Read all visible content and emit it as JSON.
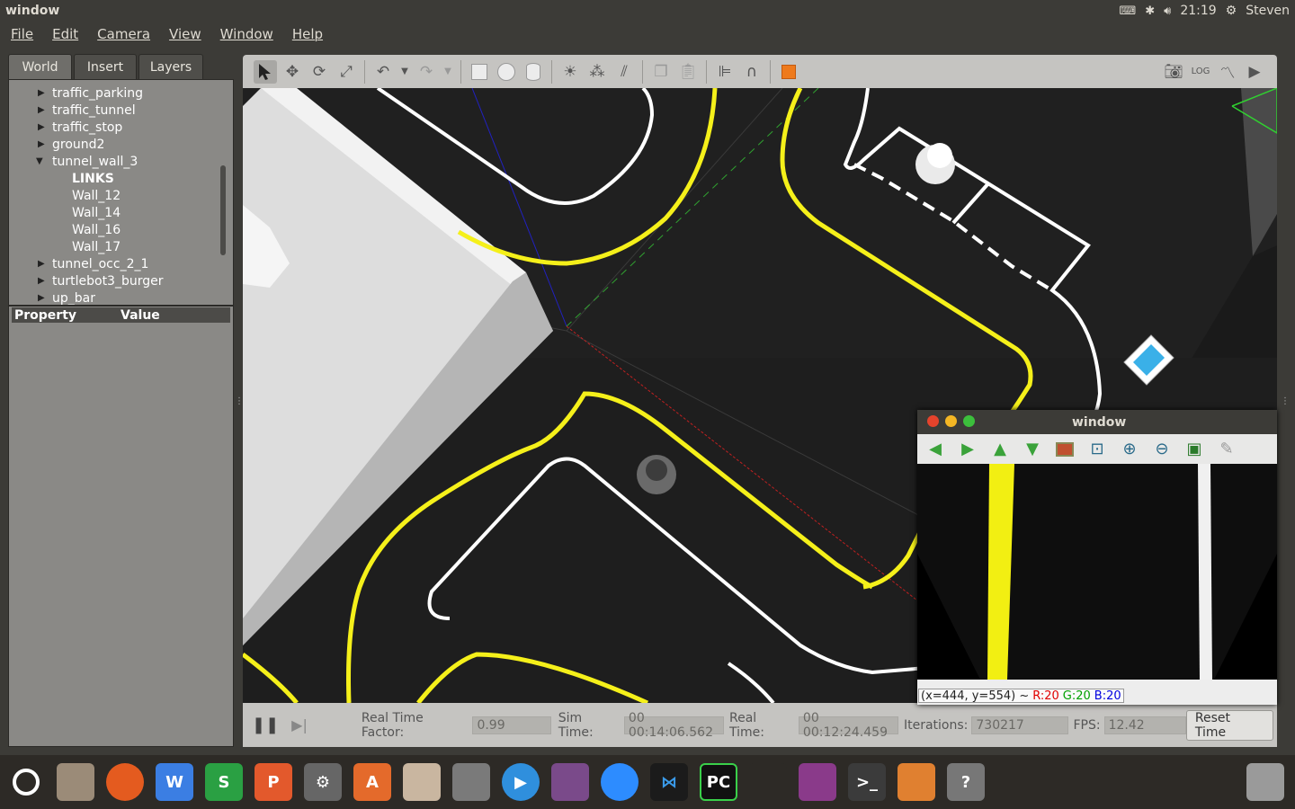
{
  "topbar": {
    "title": "window",
    "clock": "21:19",
    "user": "Steven",
    "icons": [
      "keyboard-icon",
      "bluetooth-icon",
      "volume-icon",
      "settings-gear-icon"
    ]
  },
  "menu": [
    "File",
    "Edit",
    "Camera",
    "View",
    "Window",
    "Help"
  ],
  "left_panel": {
    "tabs": [
      "World",
      "Insert",
      "Layers"
    ],
    "active_tab": "World",
    "tree": [
      {
        "label": "traffic_parking",
        "expandable": true,
        "expanded": false,
        "level": 0
      },
      {
        "label": "traffic_tunnel",
        "expandable": true,
        "expanded": false,
        "level": 0
      },
      {
        "label": "traffic_stop",
        "expandable": true,
        "expanded": false,
        "level": 0
      },
      {
        "label": "ground2",
        "expandable": true,
        "expanded": false,
        "level": 0
      },
      {
        "label": "tunnel_wall_3",
        "expandable": true,
        "expanded": true,
        "level": 0
      },
      {
        "label": "LINKS",
        "expandable": false,
        "level": 1,
        "bold": true
      },
      {
        "label": "Wall_12",
        "expandable": false,
        "level": 1
      },
      {
        "label": "Wall_14",
        "expandable": false,
        "level": 1
      },
      {
        "label": "Wall_16",
        "expandable": false,
        "level": 1
      },
      {
        "label": "Wall_17",
        "expandable": false,
        "level": 1
      },
      {
        "label": "tunnel_occ_2_1",
        "expandable": true,
        "expanded": false,
        "level": 0
      },
      {
        "label": "turtlebot3_burger",
        "expandable": true,
        "expanded": false,
        "level": 0
      },
      {
        "label": "up_bar",
        "expandable": true,
        "expanded": false,
        "level": 0
      }
    ],
    "property_header": {
      "property": "Property",
      "value": "Value"
    }
  },
  "toolbar": {
    "left_tools": [
      "select-arrow-icon",
      "translate-icon",
      "rotate-icon",
      "scale-icon",
      "undo-icon",
      "undo-dropdown-icon",
      "redo-icon",
      "redo-dropdown-icon",
      "box-shape-icon",
      "sphere-shape-icon",
      "cylinder-shape-icon",
      "point-light-icon",
      "spot-light-icon",
      "directional-light-icon",
      "copy-icon",
      "paste-icon",
      "align-icon",
      "snap-magnet-icon",
      "view-angle-icon"
    ],
    "right_tools": [
      "screenshot-camera-icon",
      "log-icon",
      "plot-icon",
      "record-video-icon"
    ]
  },
  "bottom_bar": {
    "rtf_label": "Real Time Factor:",
    "rtf_value": "0.99",
    "sim_time_label": "Sim Time:",
    "sim_time_value": "00 00:14:06.562",
    "real_time_label": "Real Time:",
    "real_time_value": "00 00:12:24.459",
    "iterations_label": "Iterations:",
    "iterations_value": "730217",
    "fps_label": "FPS:",
    "fps_value": "12.42",
    "reset_button": "Reset Time"
  },
  "cv_window": {
    "title": "window",
    "tools": [
      "pan-left-icon",
      "pan-right-icon",
      "pan-up-icon",
      "pan-down-icon",
      "zoom-image-icon",
      "zoom-fit-icon",
      "zoom-in-icon",
      "zoom-out-icon",
      "save-icon",
      "properties-icon"
    ],
    "status_coords": "(x=444, y=554) ~",
    "status_r": "R:20",
    "status_g": "G:20",
    "status_b": "B:20",
    "colors": {
      "r": "#e00000",
      "g": "#00a000",
      "b": "#0000e0"
    }
  },
  "dock": {
    "items": [
      {
        "name": "ubuntu-logo-icon",
        "glyph": "",
        "color": "#2d2a26"
      },
      {
        "name": "files-icon",
        "glyph": "",
        "color": "#8a7a6a"
      },
      {
        "name": "firefox-icon",
        "glyph": "",
        "color": "#e45b1f"
      },
      {
        "name": "wps-writer-icon",
        "glyph": "W",
        "color": "#3b7ee3"
      },
      {
        "name": "wps-spreadsheet-icon",
        "glyph": "S",
        "color": "#2aa043"
      },
      {
        "name": "wps-presentation-icon",
        "glyph": "P",
        "color": "#e3592c"
      },
      {
        "name": "system-tools-icon",
        "glyph": "",
        "color": "#555"
      },
      {
        "name": "software-center-icon",
        "glyph": "A",
        "color": "#e46a2b"
      },
      {
        "name": "mixer-icon",
        "glyph": "",
        "color": "#c9b6a0"
      },
      {
        "name": "image-viewer-icon",
        "glyph": "",
        "color": "#6a6a6a"
      },
      {
        "name": "media-player-icon",
        "glyph": "",
        "color": "#2f8fdd"
      },
      {
        "name": "video-editor-icon",
        "glyph": "",
        "color": "#7a4a8a"
      },
      {
        "name": "zoom-app-icon",
        "glyph": "",
        "color": "#2d8cff"
      },
      {
        "name": "vscode-icon",
        "glyph": "",
        "color": "#1b1b1b"
      },
      {
        "name": "pycharm-icon",
        "glyph": "PC",
        "color": "#111"
      },
      {
        "name": "window-switcher-icon",
        "glyph": "",
        "color": "#2d2a26"
      },
      {
        "name": "app-window-icon",
        "glyph": "",
        "color": "#8a3a8a"
      },
      {
        "name": "terminal-icon",
        "glyph": ">_",
        "color": "#3b3b3b"
      },
      {
        "name": "gazebo-icon",
        "glyph": "",
        "color": "#e08030"
      },
      {
        "name": "unknown-app-icon",
        "glyph": "?",
        "color": "#777"
      },
      {
        "name": "trash-icon",
        "glyph": "",
        "color": "#2d2a26"
      }
    ]
  }
}
